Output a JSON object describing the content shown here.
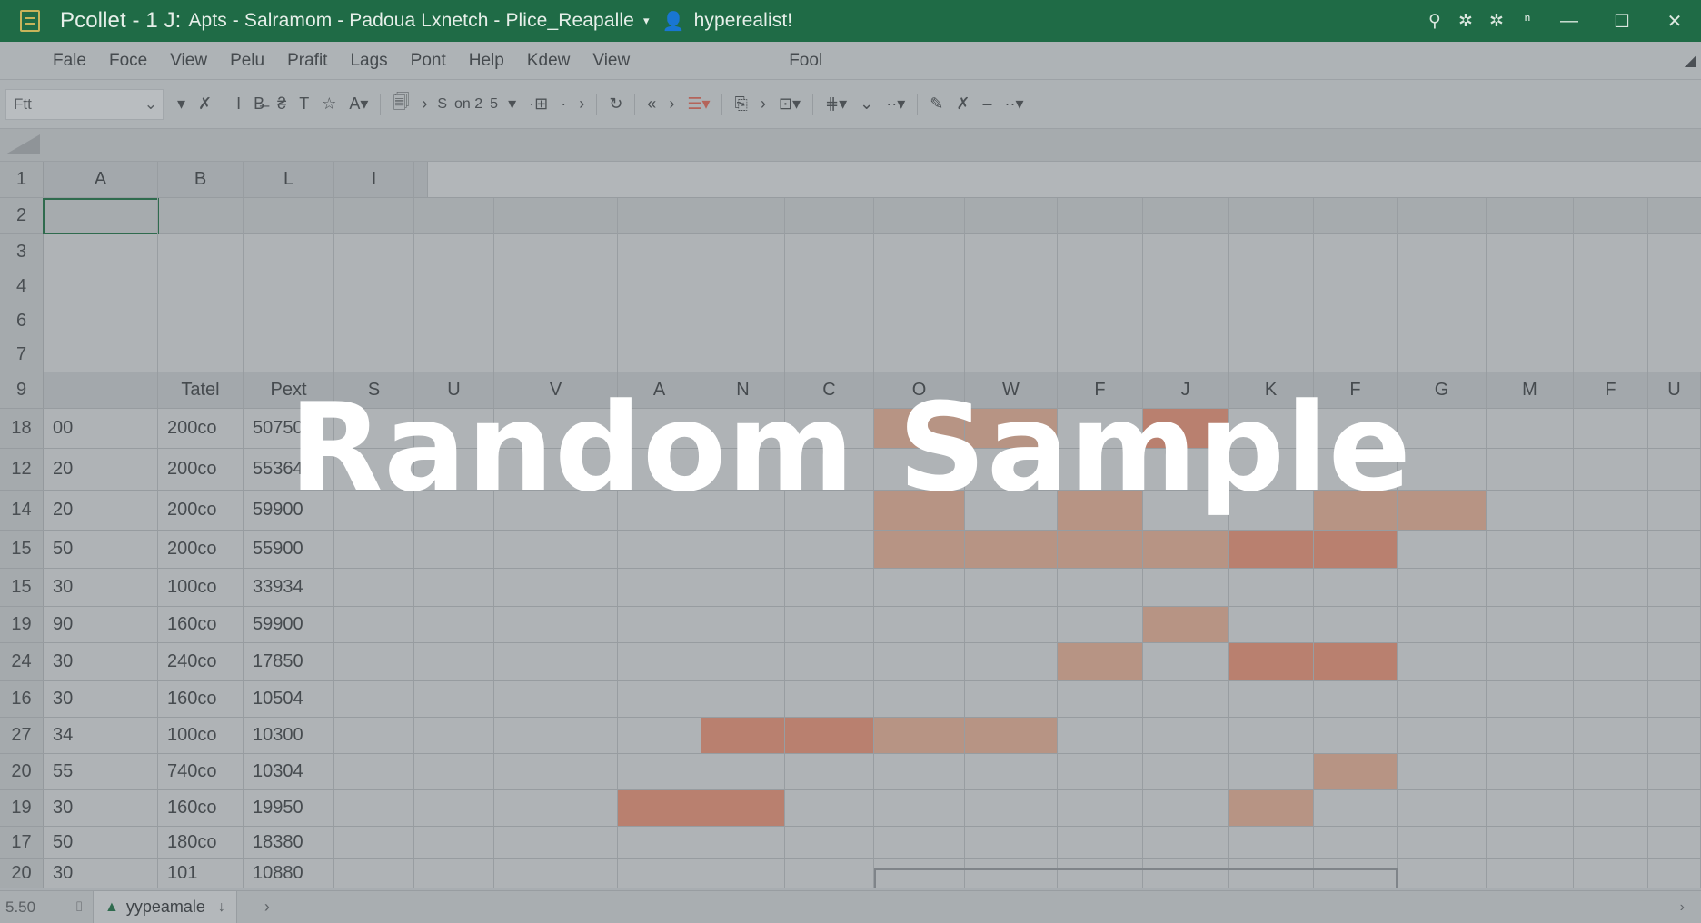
{
  "titlebar": {
    "doc_name": "Pcollet - 1 J:",
    "path": "Apts - Salramom - Padoua Lxnetch - Plice_Reapalle",
    "user": "hyperealist!"
  },
  "menu": [
    "Fale",
    "Foce",
    "View",
    "Pelu",
    "Prafit",
    "Lags",
    "Pont",
    "Help",
    "Kdew",
    "View"
  ],
  "menu_tool": "Fool",
  "toolbar": {
    "font_value": "Ftt",
    "text1": "S",
    "text2": "on 2",
    "text3": "5"
  },
  "top_header_cols": [
    "A",
    "B",
    "L",
    "I"
  ],
  "top_row_numbers": [
    "1",
    "2",
    "3",
    "4",
    "6",
    "7"
  ],
  "header_row": {
    "number": "9",
    "cols": [
      "",
      "Tatel",
      "Pext",
      "S",
      "U",
      "V",
      "A",
      "N",
      "C",
      "O",
      "W",
      "F",
      "J",
      "K",
      "F",
      "G",
      "M",
      "F",
      "U"
    ]
  },
  "rows": [
    {
      "n": "18",
      "a": "00",
      "b": "200co",
      "c": "50750"
    },
    {
      "n": "12",
      "a": "20",
      "b": "200co",
      "c": "55364"
    },
    {
      "n": "14",
      "a": "20",
      "b": "200co",
      "c": "59900"
    },
    {
      "n": "15",
      "a": "50",
      "b": "200co",
      "c": "55900"
    },
    {
      "n": "15",
      "a": "30",
      "b": "100co",
      "c": "33934"
    },
    {
      "n": "19",
      "a": "90",
      "b": "160co",
      "c": "59900"
    },
    {
      "n": "24",
      "a": "30",
      "b": "240co",
      "c": "17850"
    },
    {
      "n": "16",
      "a": "30",
      "b": "160co",
      "c": "10504"
    },
    {
      "n": "27",
      "a": "34",
      "b": "100co",
      "c": "10300"
    },
    {
      "n": "20",
      "a": "55",
      "b": "740co",
      "c": "10304"
    },
    {
      "n": "19",
      "a": "30",
      "b": "160co",
      "c": "19950"
    },
    {
      "n": "17",
      "a": "50",
      "b": "180co",
      "c": "18380"
    },
    {
      "n": "20",
      "a": "30",
      "b": "101",
      "c": "10880"
    }
  ],
  "tabbar": {
    "count": "5.50",
    "sheet_name": "yypeamale"
  },
  "watermark": "Random Sample",
  "colors": {
    "title_green": "#1f6b46",
    "highlight": "#b9806f",
    "highlight_light": "#b79484"
  }
}
